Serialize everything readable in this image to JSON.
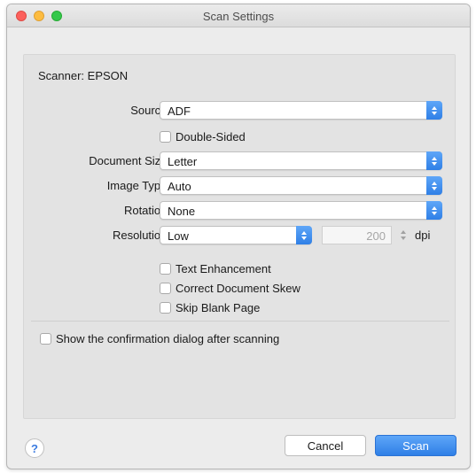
{
  "window": {
    "title": "Scan Settings"
  },
  "scanner": {
    "label": "Scanner: EPSON"
  },
  "source": {
    "label": "Source:",
    "value": "ADF"
  },
  "double_sided": {
    "label": "Double-Sided",
    "checked": false
  },
  "document_size": {
    "label": "Document Size:",
    "value": "Letter"
  },
  "image_type": {
    "label": "Image Type:",
    "value": "Auto"
  },
  "rotation": {
    "label": "Rotation:",
    "value": "None"
  },
  "resolution": {
    "label": "Resolution:",
    "value": "Low",
    "dpi_value": "200",
    "unit": "dpi"
  },
  "options": {
    "text_enhancement": {
      "label": "Text Enhancement",
      "checked": false
    },
    "correct_skew": {
      "label": "Correct Document Skew",
      "checked": false
    },
    "skip_blank": {
      "label": "Skip Blank Page",
      "checked": false
    }
  },
  "confirmation": {
    "label": "Show the confirmation dialog after scanning",
    "checked": false
  },
  "help": {
    "glyph": "?"
  },
  "buttons": {
    "cancel": "Cancel",
    "scan": "Scan"
  },
  "colors": {
    "accent": "#3d8ef0"
  }
}
